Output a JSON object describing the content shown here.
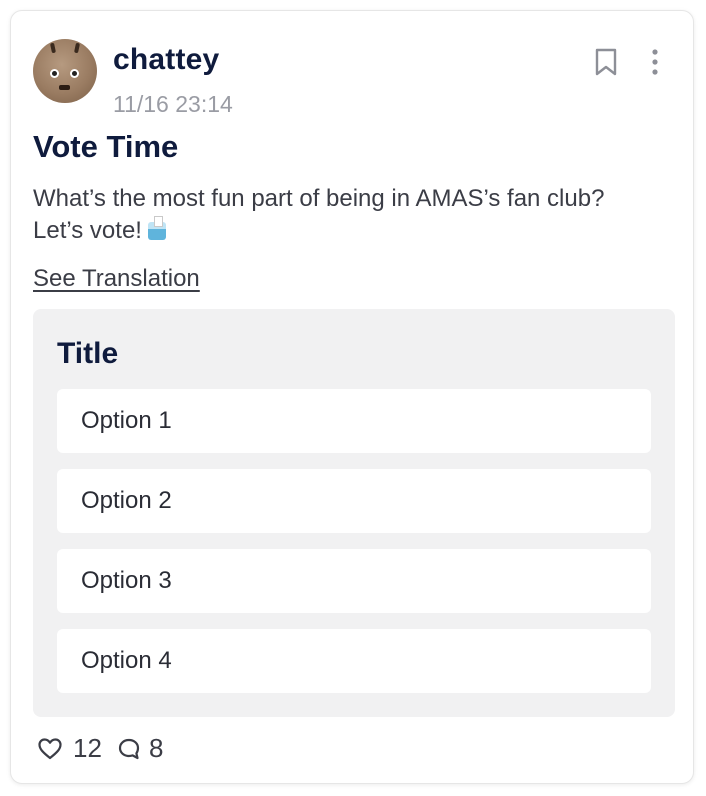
{
  "post": {
    "username": "chattey",
    "timestamp": "11/16  23:14",
    "title": "Vote Time",
    "body_line1": "What’s the most fun part of being in AMAS’s fan club?",
    "body_line2": "Let’s vote!",
    "see_translation": "See Translation"
  },
  "poll": {
    "title": "Title",
    "options": [
      {
        "label": "Option 1"
      },
      {
        "label": "Option 2"
      },
      {
        "label": "Option 3"
      },
      {
        "label": "Option 4"
      }
    ]
  },
  "footer": {
    "likes": "12",
    "comments": "8"
  },
  "icons": {
    "avatar": "monster-avatar",
    "bookmark": "bookmark-icon",
    "more": "more-vertical-icon",
    "ballot": "ballot-box-emoji",
    "like": "heart-icon",
    "comment": "comment-icon"
  },
  "colors": {
    "title_text": "#0f1b3d",
    "body_text": "#3b3d46",
    "meta_text": "#9a9ca4",
    "poll_background": "#f1f1f2",
    "option_background": "#ffffff"
  }
}
